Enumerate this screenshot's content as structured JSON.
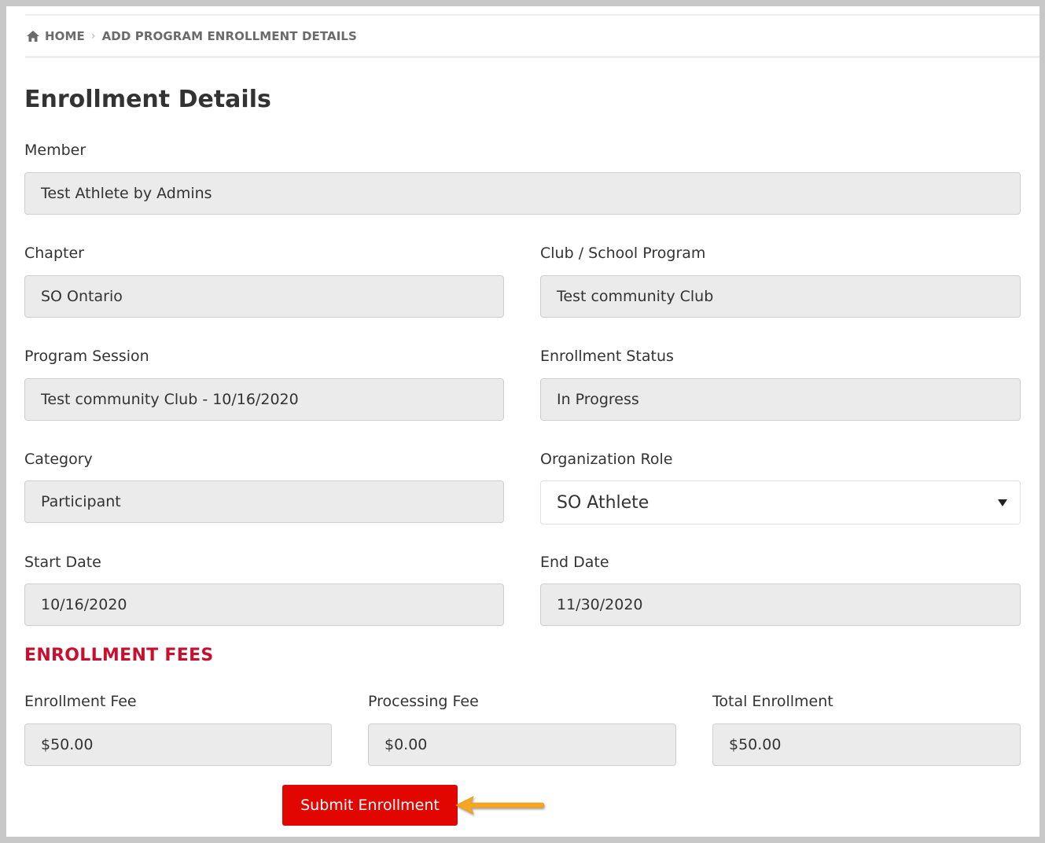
{
  "breadcrumb": {
    "home": "HOME",
    "separator": "›",
    "current": "ADD PROGRAM ENROLLMENT DETAILS"
  },
  "page_title": "Enrollment Details",
  "fields": {
    "member": {
      "label": "Member",
      "value": "Test Athlete by Admins"
    },
    "chapter": {
      "label": "Chapter",
      "value": "SO Ontario"
    },
    "club_program": {
      "label": "Club / School Program",
      "value": "Test community Club"
    },
    "program_session": {
      "label": "Program Session",
      "value": "Test community Club - 10/16/2020"
    },
    "enrollment_status": {
      "label": "Enrollment Status",
      "value": "In Progress"
    },
    "category": {
      "label": "Category",
      "value": "Participant"
    },
    "organization_role": {
      "label": "Organization Role",
      "value": "SO Athlete"
    },
    "start_date": {
      "label": "Start Date",
      "value": "10/16/2020"
    },
    "end_date": {
      "label": "End Date",
      "value": "11/30/2020"
    }
  },
  "fees": {
    "heading": "ENROLLMENT FEES",
    "enrollment_fee": {
      "label": "Enrollment Fee",
      "value": "$50.00"
    },
    "processing_fee": {
      "label": "Processing Fee",
      "value": "$0.00"
    },
    "total_enrollment": {
      "label": "Total Enrollment",
      "value": "$50.00"
    }
  },
  "submit_label": "Submit Enrollment",
  "icons": {
    "home": "home-icon",
    "dropdown": "chevron-down-icon",
    "callout": "arrow-left-icon"
  },
  "colors": {
    "accent_red": "#c8102e",
    "button_red": "#e10600",
    "arrow_orange": "#f5a623",
    "field_bg": "#ebebeb"
  }
}
